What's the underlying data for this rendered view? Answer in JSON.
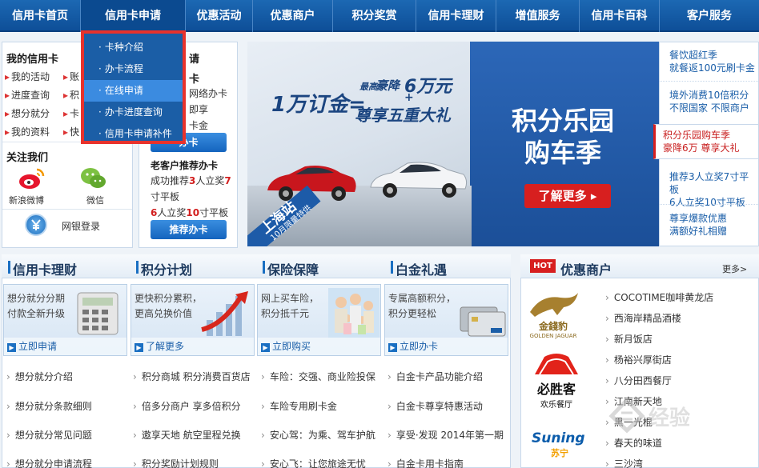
{
  "nav": {
    "items": [
      "信用卡首页",
      "信用卡申请",
      "优惠活动",
      "优惠商户",
      "积分奖赏",
      "信用卡理财",
      "增值服务",
      "信用卡百科",
      "客户服务"
    ]
  },
  "dropdown": {
    "items": [
      "卡种介绍",
      "办卡流程",
      "在线申请",
      "办卡进度查询",
      "信用卡申请补件"
    ]
  },
  "my_card": {
    "title": "我的信用卡",
    "links": [
      "我的活动",
      "进度查询",
      "想分就分",
      "我的资料"
    ],
    "links2": [
      "账",
      "积",
      "卡",
      "快"
    ]
  },
  "follow": {
    "title": "关注我们",
    "weibo": "新浪微博",
    "wechat": "微信",
    "netbank": "网银登录"
  },
  "apply_panel": {
    "title": "请",
    "subtitle": "卡",
    "lines": [
      "网络办卡",
      "即享",
      "卡金"
    ],
    "btn": "办卡",
    "ref_title": "老客户推荐办卡",
    "ref_a": "成功推荐",
    "ref_n1": "3",
    "ref_b": "人立奖",
    "ref_n2": "7",
    "ref_c": "寸平板",
    "ref2_n1": "6",
    "ref2_a": "人立奖",
    "ref2_n2": "10",
    "ref2_b": "寸平板",
    "ref_btn": "推荐办卡"
  },
  "banner": {
    "deposit": "1万订金=",
    "highest": "最高",
    "luxury": "豪降",
    "amount": "6万元",
    "plus": "+",
    "gift": "尊享五重大礼",
    "title1": "积分乐园",
    "title2": "购车季",
    "more": "了解更多",
    "city": "上海站",
    "date": "10月限量特供"
  },
  "side_promos": [
    {
      "l1": "餐饮超红季",
      "l2": "就餐返100元刷卡金"
    },
    {
      "l1": "境外消费10倍积分",
      "l2": "不限国家 不限商户"
    },
    {
      "l1": "积分乐园购车季",
      "l2": "豪降6万 尊享大礼"
    },
    {
      "l1": "推荐3人立奖7寸平板",
      "l2": "6人立奖10寸平板"
    },
    {
      "l1": "尊享爆款优惠",
      "l2": "满额好礼相赠"
    }
  ],
  "modules": [
    {
      "title": "信用卡理财",
      "desc1": "想分就分分期",
      "desc2": "付款全新升级",
      "btn": "立即申请",
      "links": [
        "想分就分介绍",
        "想分就分条款细则",
        "想分就分常见问题",
        "想分就分申请流程"
      ]
    },
    {
      "title": "积分计划",
      "desc1": "更快积分累积，",
      "desc2": "更高兑换价值",
      "btn": "了解更多",
      "links": [
        "积分商城 积分消费百货店",
        "倍多分商户 享多倍积分",
        "遨享天地 航空里程兑换",
        "积分奖励计划规则"
      ]
    },
    {
      "title": "保险保障",
      "desc1": "网上买车险，",
      "desc2": "积分抵千元",
      "btn": "立即购买",
      "links": [
        "车险：交强、商业险投保",
        "车险专用刷卡金",
        "安心驾：为乘、驾车护航",
        "安心飞：让您旅途无忧"
      ]
    },
    {
      "title": "白金礼遇",
      "desc1": "专属高额积分，",
      "desc2": "积分更轻松",
      "btn": "立即办卡",
      "links": [
        "白金卡产品功能介绍",
        "白金卡尊享特惠活动",
        "享受·发现 2014年第一期",
        "白金卡用卡指南"
      ]
    }
  ],
  "merchants": {
    "hot": "HOT",
    "title": "优惠商户",
    "more": "更多>",
    "items": [
      "COCOTIME咖啡黄龙店",
      "西海岸精品酒楼",
      "新月饭店",
      "杨裕兴厚街店",
      "八分田西餐厅",
      "江南新天地",
      "黑一光棍",
      "春天的味道",
      "三沙湾"
    ],
    "logo1a": "金錢豹",
    "logo1b": "GOLDEN JAGUAR",
    "logo2a": "必胜客",
    "logo2b": "欢乐餐厅",
    "logo3a": "Suning",
    "logo3b": "苏宁"
  },
  "watermark": "经验"
}
